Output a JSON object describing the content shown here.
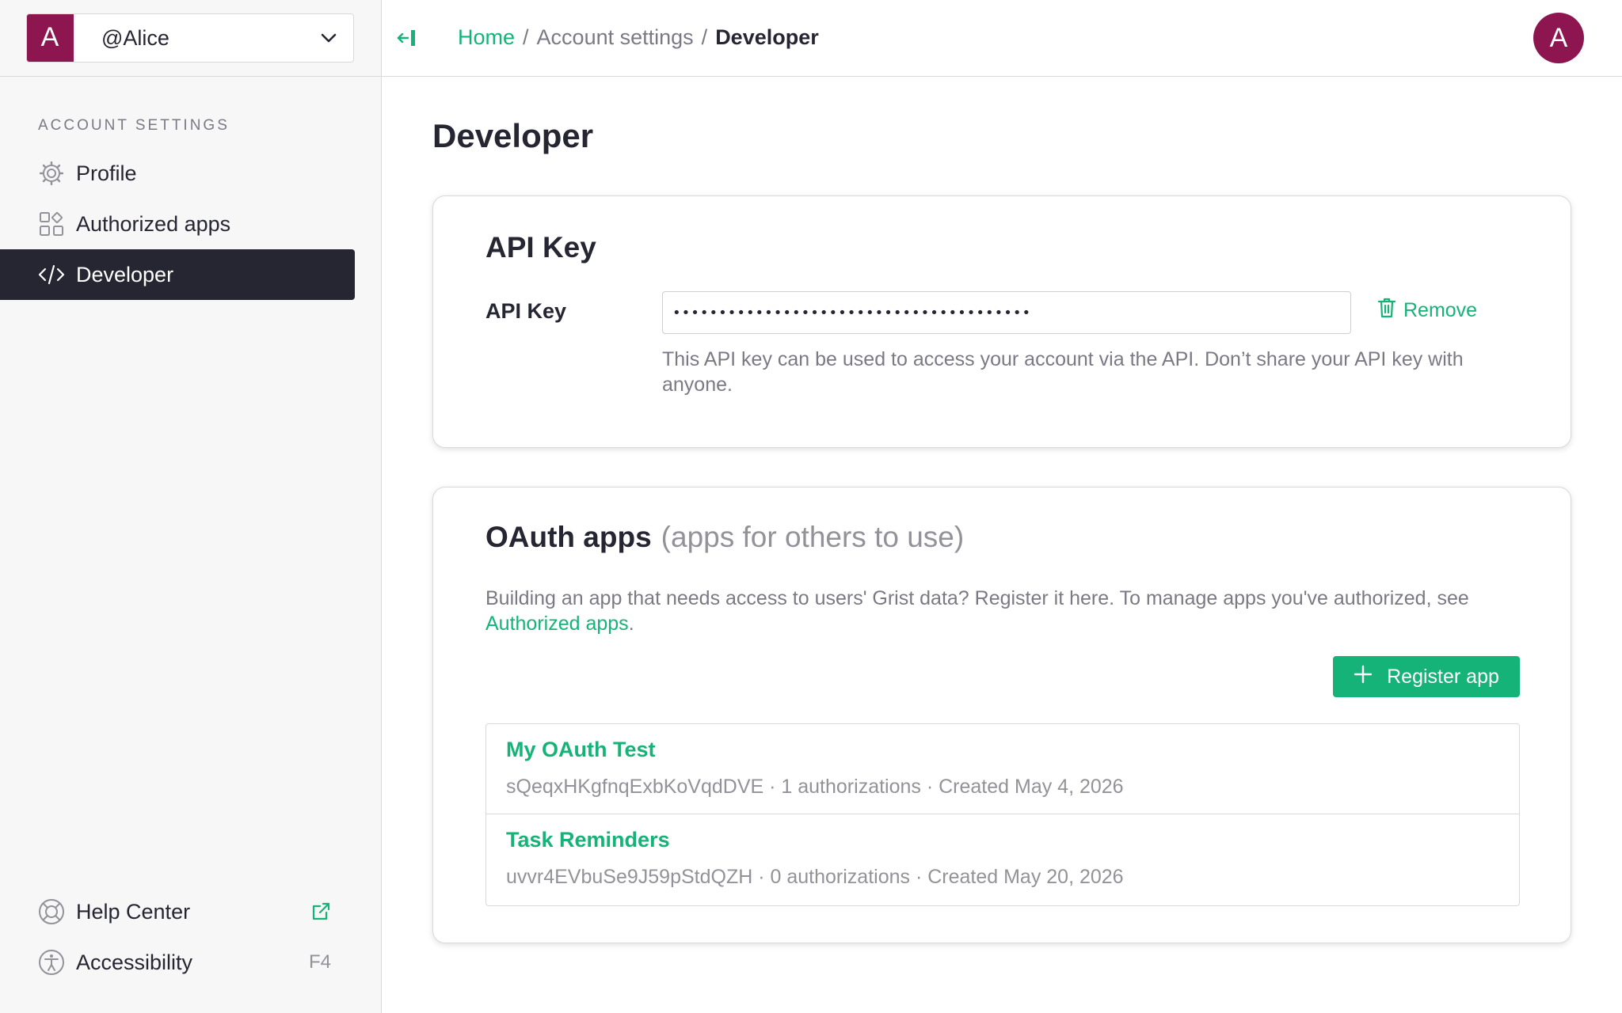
{
  "account": {
    "initial": "A",
    "name": "@Alice"
  },
  "sidebar": {
    "section_title": "ACCOUNT SETTINGS",
    "items": [
      {
        "label": "Profile",
        "icon": "gear-icon"
      },
      {
        "label": "Authorized apps",
        "icon": "apps-grid-icon"
      },
      {
        "label": "Developer",
        "icon": "code-icon",
        "active": true
      }
    ],
    "footer": [
      {
        "label": "Help Center",
        "icon": "lifebuoy-icon",
        "trailing_icon": "external-link-icon"
      },
      {
        "label": "Accessibility",
        "icon": "accessibility-icon",
        "shortcut": "F4"
      }
    ]
  },
  "breadcrumb": {
    "home": "Home",
    "separator": "/",
    "middle": "Account settings",
    "current": "Developer"
  },
  "user_avatar": {
    "initial": "A"
  },
  "page": {
    "title": "Developer"
  },
  "api_key": {
    "heading": "API Key",
    "label": "API Key",
    "masked_value": "•••••••••••••••••••••••••••••••••••••••",
    "remove_label": "Remove",
    "help_text": "This API key can be used to access your account via the API. Don’t share your API key with anyone."
  },
  "oauth": {
    "heading": "OAuth apps",
    "subheading": "(apps for others to use)",
    "description_prefix": "Building an app that needs access to users' Grist data? Register it here. To manage apps you've authorized, see ",
    "description_link": "Authorized apps",
    "description_suffix": ".",
    "register_label": "Register app",
    "apps": [
      {
        "name": "My OAuth Test",
        "meta": "sQeqxHKgfnqExbKoVqdDVE · 1 authorizations · Created May 4, 2026"
      },
      {
        "name": "Task Reminders",
        "meta": "uvvr4EVbuSe9J59pStdQZH · 0 authorizations · Created May 20, 2026"
      }
    ]
  },
  "colors": {
    "accent": "#16b378",
    "brand": "#8d1651",
    "active_nav": "#262633",
    "muted_text": "#7a7a85"
  }
}
